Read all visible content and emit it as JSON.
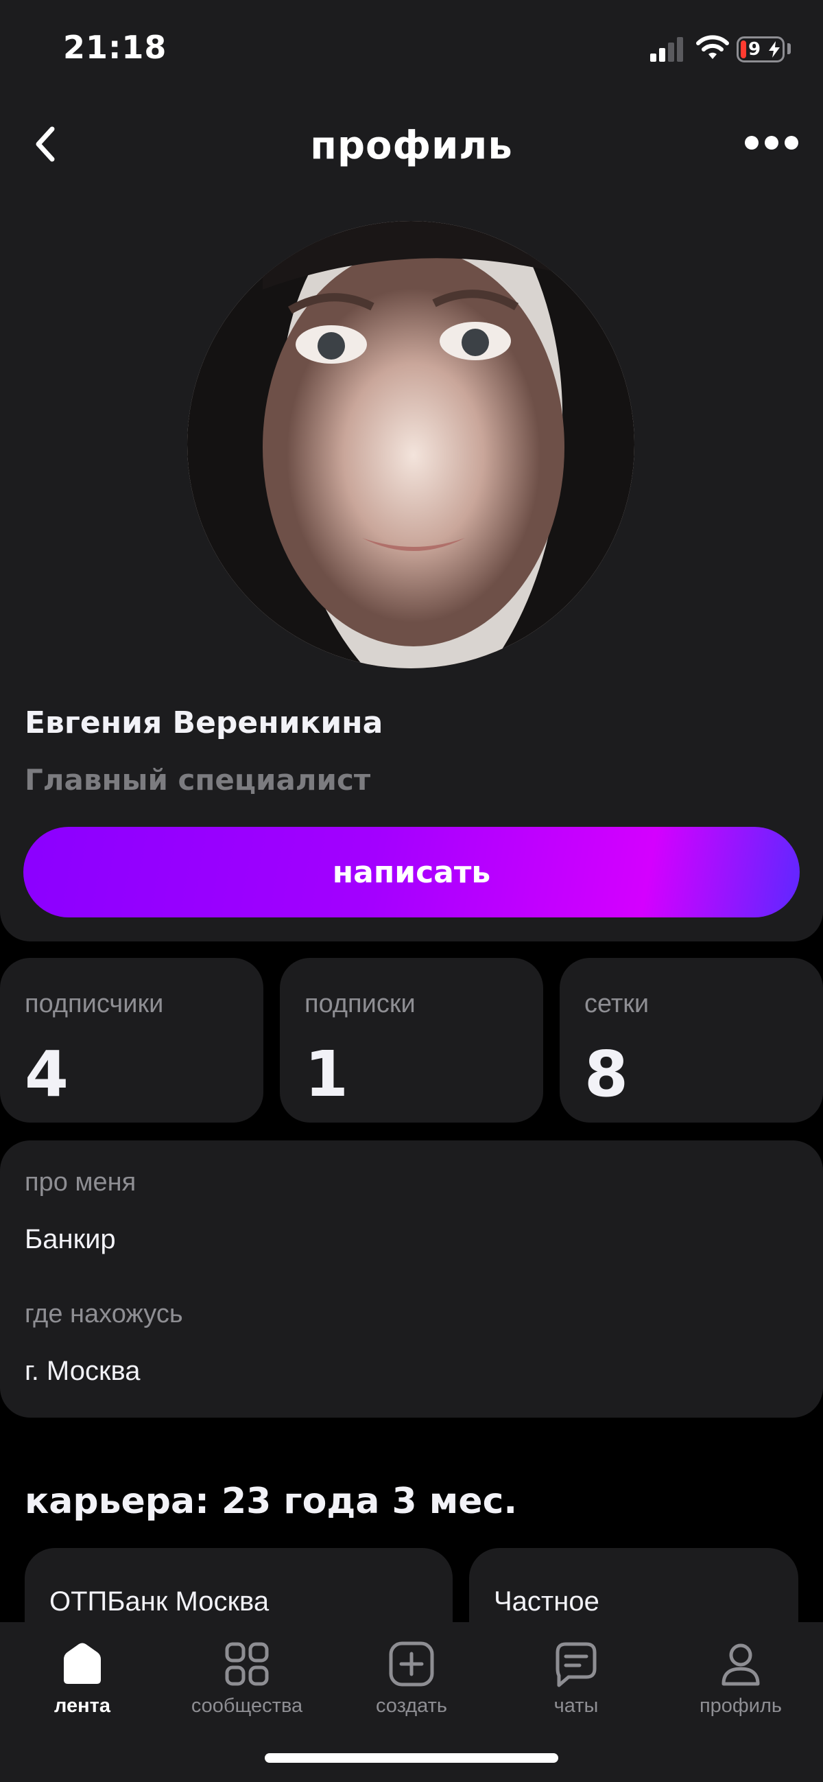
{
  "status_bar": {
    "time": "21:18",
    "battery": "9"
  },
  "header": {
    "title": "профиль"
  },
  "profile": {
    "name": "Евгения Вереникина",
    "job_title": "Главный специалист",
    "write_button": "написать"
  },
  "stats": [
    {
      "label": "подписчики",
      "value": "4"
    },
    {
      "label": "подписки",
      "value": "1"
    },
    {
      "label": "сетки",
      "value": "8"
    }
  ],
  "about": {
    "about_label": "про меня",
    "about_value": "Банкир",
    "location_label": "где нахожусь",
    "location_value": "г. Москва"
  },
  "career": {
    "title": "карьера: 23 года 3 мес.",
    "items": [
      "ОТПБанк Москва",
      "Частное"
    ]
  },
  "tabs": [
    {
      "label": "лента",
      "icon": "home-icon",
      "active": true
    },
    {
      "label": "сообщества",
      "icon": "grid-icon",
      "active": false
    },
    {
      "label": "создать",
      "icon": "plus-square-icon",
      "active": false
    },
    {
      "label": "чаты",
      "icon": "chat-icon",
      "active": false
    },
    {
      "label": "профиль",
      "icon": "person-icon",
      "active": false
    }
  ],
  "colors": {
    "background": "#000000",
    "card": "#1c1c1e",
    "accent_start": "#8b00ff",
    "accent_end": "#5e28ff",
    "muted_text": "#8e8e93"
  }
}
